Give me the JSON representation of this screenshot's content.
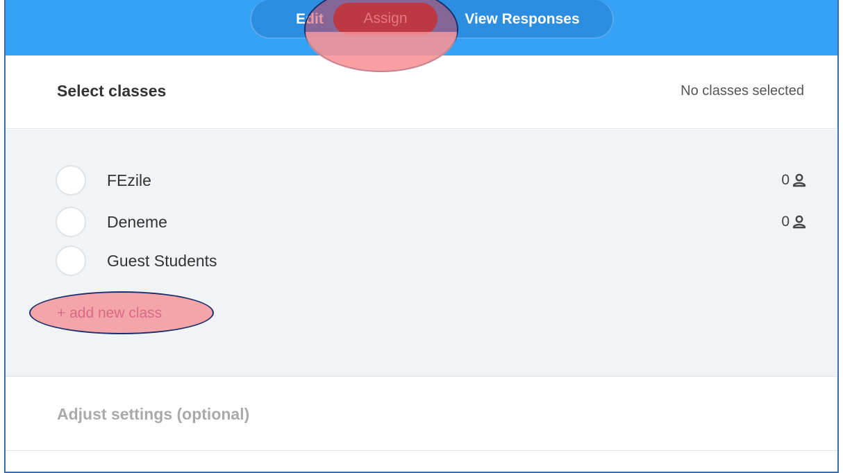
{
  "tabs": {
    "edit": "Edit",
    "assign": "Assign",
    "view_responses": "View Responses"
  },
  "select_section": {
    "title": "Select classes",
    "status": "No classes selected"
  },
  "classes": [
    {
      "name": "FEzile",
      "count": "0",
      "icon": "user-icon"
    },
    {
      "name": "Deneme",
      "count": "0",
      "icon": "user-icon"
    },
    {
      "name": "Guest Students",
      "count": "",
      "icon": ""
    }
  ],
  "add_class_label": "+ add new class",
  "settings_section": {
    "title": "Adjust settings (optional)"
  },
  "colors": {
    "topbar": "#35a2f5",
    "assign_active": "#a32a2a",
    "annotation": "#d2465a"
  }
}
